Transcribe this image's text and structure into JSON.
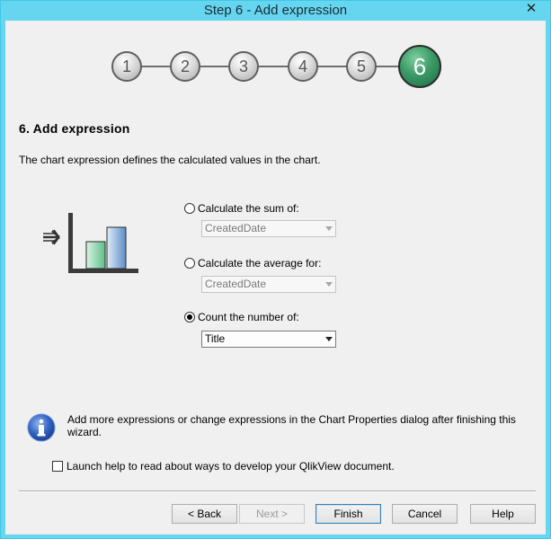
{
  "window": {
    "title": "Step 6 - Add expression",
    "close_glyph": "✕"
  },
  "steps": [
    "1",
    "2",
    "3",
    "4",
    "5",
    "6"
  ],
  "active_step": 6,
  "heading": "6. Add expression",
  "description": "The chart expression defines the calculated values in the chart.",
  "options": [
    {
      "label": "Calculate the sum of:",
      "selected": false,
      "field": "CreatedDate",
      "enabled": false
    },
    {
      "label": "Calculate the average for:",
      "selected": false,
      "field": "CreatedDate",
      "enabled": false
    },
    {
      "label": "Count the number of:",
      "selected": true,
      "field": "Title",
      "enabled": true
    }
  ],
  "info": {
    "icon": "info-icon",
    "text": "Add more expressions or change expressions in the Chart Properties dialog after finishing this wizard."
  },
  "help_checkbox": {
    "label": "Launch help to read about ways to develop your QlikView document.",
    "checked": false
  },
  "buttons": {
    "back": "< Back",
    "next": "Next >",
    "finish": "Finish",
    "cancel": "Cancel",
    "help": "Help"
  },
  "colors": {
    "title_bar": "#66d6f0",
    "active_step": "#3b9a66"
  }
}
